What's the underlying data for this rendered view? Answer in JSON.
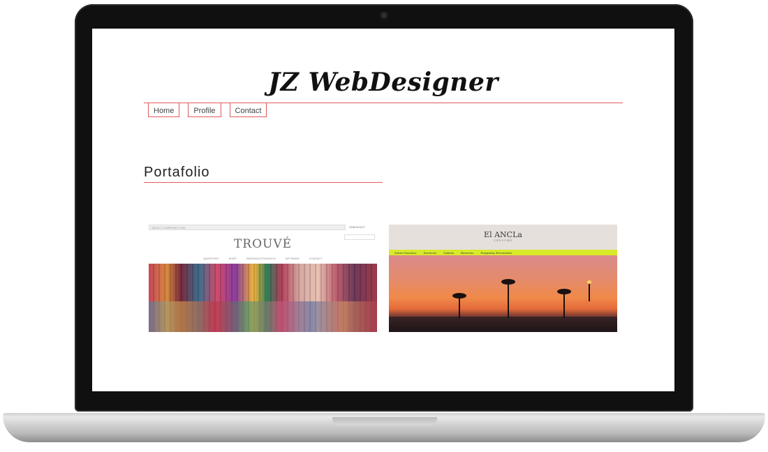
{
  "site": {
    "title": "JZ WebDesigner",
    "nav": [
      "Home",
      "Profile",
      "Contact"
    ]
  },
  "section": {
    "title": "Portafolio"
  },
  "portfolio": [
    {
      "name": "trouve",
      "logo": "TROUVÉ",
      "topbar": "SELECT CURRENCY   USD",
      "checkout": "CHECKOUT",
      "menu": [
        "QUESTORY",
        "SHOP",
        "INDIGNOU/TOHIO/CHI",
        "ARTISANS",
        "CONTACT"
      ]
    },
    {
      "name": "el-ancla",
      "logo": "El ANCLa",
      "logo_sub": "CEVICHE",
      "menu": [
        "Sobre Nosotros",
        "Servicios",
        "Galería",
        "Reservas",
        "Preguntas Frecuentes"
      ]
    }
  ],
  "colors": {
    "accent": "#e05a5a",
    "menu_highlight": "#d8ea2a"
  }
}
